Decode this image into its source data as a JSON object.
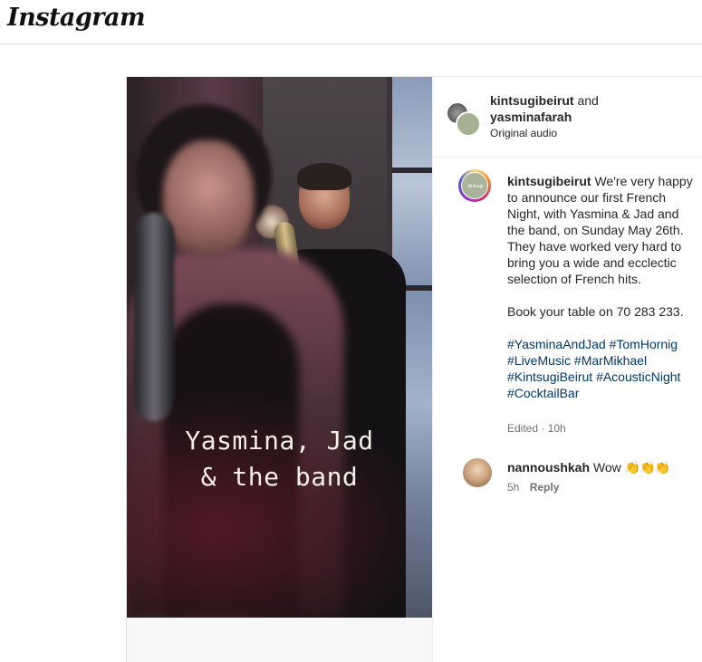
{
  "app": {
    "logo": "Instagram"
  },
  "post": {
    "media": {
      "overlay_line1": "Yasmina, Jad",
      "overlay_line2": "& the band"
    },
    "header": {
      "user1": "kintsugibeirut",
      "and_word": "and",
      "user2": "yasminafarah",
      "audio": "Original audio"
    },
    "caption": {
      "author": "kintsugibeirut",
      "text": "We're very happy to announce our first French Night, with Yasmina & Jad and the band, on Sunday May 26th. They have worked very hard to bring you a wide and ecclectic selection of French hits.",
      "booking": "Book your table on 70 283 233.",
      "tags": [
        "#YasminaAndJad",
        "#TomHornig",
        "#LiveMusic",
        "#MarMikhael",
        "#KintsugiBeirut",
        "#AcousticNight",
        "#CocktailBar"
      ],
      "avatar_text": "kintsugi"
    },
    "meta": {
      "edited": "Edited",
      "sep": " · ",
      "time": "10h"
    },
    "comments": [
      {
        "user": "nannoushkah",
        "text": "Wow",
        "emoji": "👏👏👏",
        "time": "5h",
        "reply": "Reply"
      }
    ]
  }
}
